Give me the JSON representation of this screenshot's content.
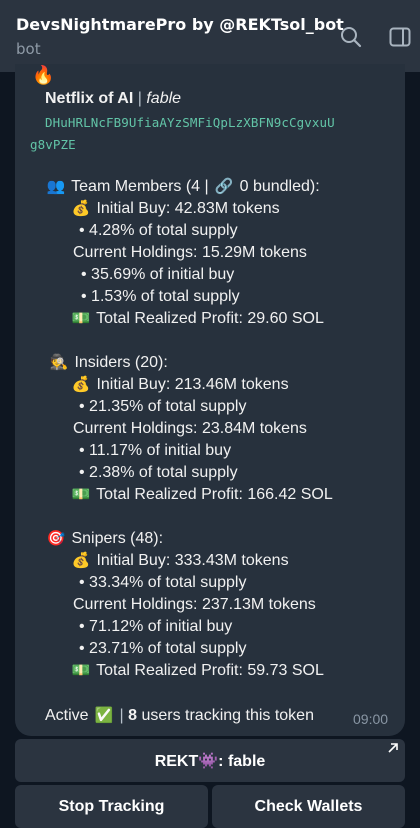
{
  "header": {
    "title": "DevsNightmarePro by @REKTsol_bot",
    "subtitle": "bot",
    "search_icon": "search-icon",
    "panel_icon": "side-panel-icon"
  },
  "message": {
    "top_emoji": "🔥",
    "token_name": "Netflix of AI",
    "separator": "|",
    "token_ticker": "fable",
    "address_line1": "DHuHRLNcFB9UfiaAYzSMFiQpLzXBFN9cCgvxuU",
    "address_line2": "g8vPZE",
    "team": {
      "emoji": "👥",
      "label": "Team Members (4 |",
      "link_emoji": "🔗",
      "label_end": "0 bundled):",
      "initial_buy": "Initial Buy: 42.83M tokens",
      "initial_pct": "• 4.28% of total supply",
      "holdings": "Current Holdings: 15.29M tokens",
      "holdings_pct_initial": "• 35.69% of initial buy",
      "holdings_pct_supply": "• 1.53% of total supply",
      "profit": "Total Realized Profit: 29.60 SOL"
    },
    "insiders": {
      "emoji": "🕵",
      "label": "Insiders (20):",
      "initial_buy": "Initial Buy: 213.46M tokens",
      "initial_pct": "• 21.35% of total supply",
      "holdings": "Current Holdings: 23.84M tokens",
      "holdings_pct_initial": "• 11.17% of initial buy",
      "holdings_pct_supply": "• 2.38% of total supply",
      "profit": "Total Realized Profit: 166.42 SOL"
    },
    "snipers": {
      "emoji": "🎯",
      "label": "Snipers (48):",
      "initial_buy": "Initial Buy: 333.43M tokens",
      "initial_pct": "• 33.34% of total supply",
      "holdings": "Current Holdings: 237.13M tokens",
      "holdings_pct_initial": "• 71.12% of initial buy",
      "holdings_pct_supply": "• 23.71% of total supply",
      "profit": "Total Realized Profit: 59.73 SOL"
    },
    "moneybag_emoji": "💰",
    "cash_emoji": "💵",
    "status_active": "Active",
    "status_check": "✅",
    "status_sep": "|",
    "users_count": "8",
    "users_text": "users tracking this token",
    "time": "09:00"
  },
  "buttons": {
    "rekt": "REKT👾: fable",
    "stop": "Stop Tracking",
    "check": "Check Wallets"
  }
}
